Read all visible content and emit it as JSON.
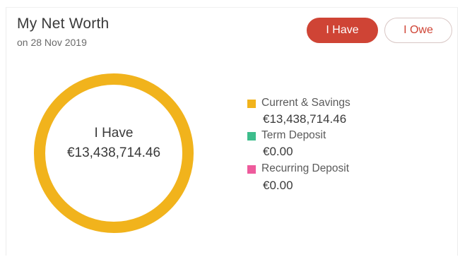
{
  "header": {
    "title": "My Net Worth",
    "subtitle": "on 28 Nov 2019"
  },
  "toggle": {
    "have_label": "I Have",
    "owe_label": "I Owe",
    "selected": "I Have"
  },
  "donut": {
    "center_label": "I Have",
    "center_value": "€13,438,714.46"
  },
  "legend": [
    {
      "name": "Current & Savings",
      "value": "€13,438,714.46",
      "color": "#f1b31c"
    },
    {
      "name": "Term Deposit",
      "value": "€0.00",
      "color": "#3dbd8c"
    },
    {
      "name": "Recurring Deposit",
      "value": "€0.00",
      "color": "#ee5b9c"
    }
  ],
  "colors": {
    "accent": "#cf4435",
    "ring": "#f1b31c"
  }
}
